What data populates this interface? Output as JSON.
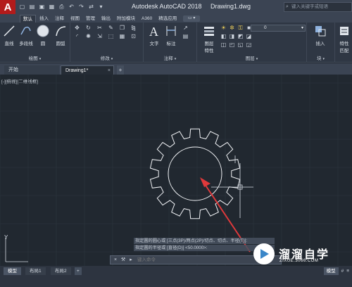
{
  "titlebar": {
    "app_title": "Autodesk AutoCAD 2018",
    "file_title": "Drawing1.dwg",
    "search_placeholder": "键入关键字或短语",
    "logo_letter": "A"
  },
  "ribbon_tabs": [
    "默认",
    "插入",
    "注释",
    "视图",
    "管理",
    "输出",
    "附加模块",
    "A360",
    "精选应用"
  ],
  "ribbon_tab_extra": "▭ ▾",
  "draw_group": {
    "label": "绘图",
    "line": "直线",
    "polyline": "多段线",
    "circle": "圆",
    "arc": "圆弧"
  },
  "modify_group": {
    "label": "修改"
  },
  "annotation_group": {
    "label": "注释",
    "text": "文字",
    "dimension": "标注"
  },
  "layers_group": {
    "label": "图层",
    "layer_props": "图层",
    "layer_props_line2": "特性",
    "current_layer": "0"
  },
  "block_group": {
    "label": "块",
    "insert": "插入"
  },
  "properties_group": {
    "label": "特性",
    "match": "特性",
    "match_line2": "匹配"
  },
  "file_tabs": {
    "start": "开始",
    "drawing": "Drawing1*",
    "add": "+"
  },
  "viewport_label": "[-][俯视][二维线框]",
  "command_history": [
    "指定圆的圆心或 [三点(3P)/两点(2P)/切点、切点、半径(T)]:",
    "指定圆的半径或 [直径(D)] <50.0000>:"
  ],
  "command_line": {
    "placeholder": "键入命令"
  },
  "watermark": {
    "title": "溜溜自学",
    "url": "ZIXUE.3066.COM"
  },
  "layout_tabs": [
    "模型",
    "布局1",
    "布局2",
    "+"
  ],
  "status": {
    "model": "模型",
    "grid": "#",
    "menu": "≡"
  },
  "ucs": {
    "y_label": "Y"
  },
  "colors": {
    "canvas": "#212830",
    "gear_stroke": "#f2f4f7",
    "arrow": "#e0393b",
    "ribbon_bg": "#2f3744"
  }
}
